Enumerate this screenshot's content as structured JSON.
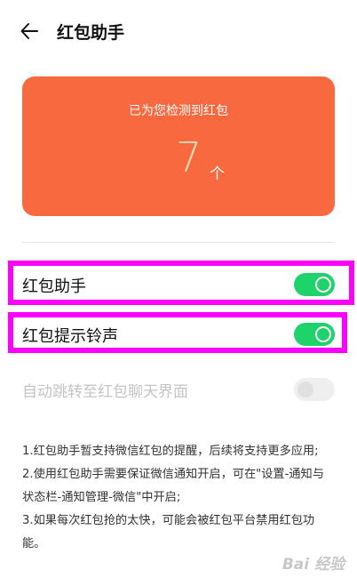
{
  "header": {
    "title": "红包助手",
    "back_icon": "arrow-left-icon"
  },
  "card": {
    "caption": "已为您检测到红包",
    "count": "7",
    "unit": "个",
    "color": "#f86940"
  },
  "settings": [
    {
      "label": "红包助手",
      "enabled": true,
      "on": true
    },
    {
      "label": "红包提示铃声",
      "enabled": true,
      "on": true
    },
    {
      "label": "自动跳转至红包聊天界面",
      "enabled": false,
      "on": false
    }
  ],
  "notes": [
    {
      "lines": [
        "1.红包助手暂支持微信红包的提醒，后续将支持更多应用;"
      ]
    },
    {
      "lines": [
        "2.使用红包助手需要保证微信通知开启，可在\"设置-通知与",
        "状态栏-通知管理-微信\"中开启;"
      ]
    },
    {
      "lines": [
        "3.如果每次红包抢的太快，可能会被红包平台禁用红包功",
        "能。"
      ]
    }
  ],
  "watermark": "Bai 经验",
  "colors": {
    "toggle_on": "#1ed36a",
    "highlight": "#ff00ff"
  }
}
